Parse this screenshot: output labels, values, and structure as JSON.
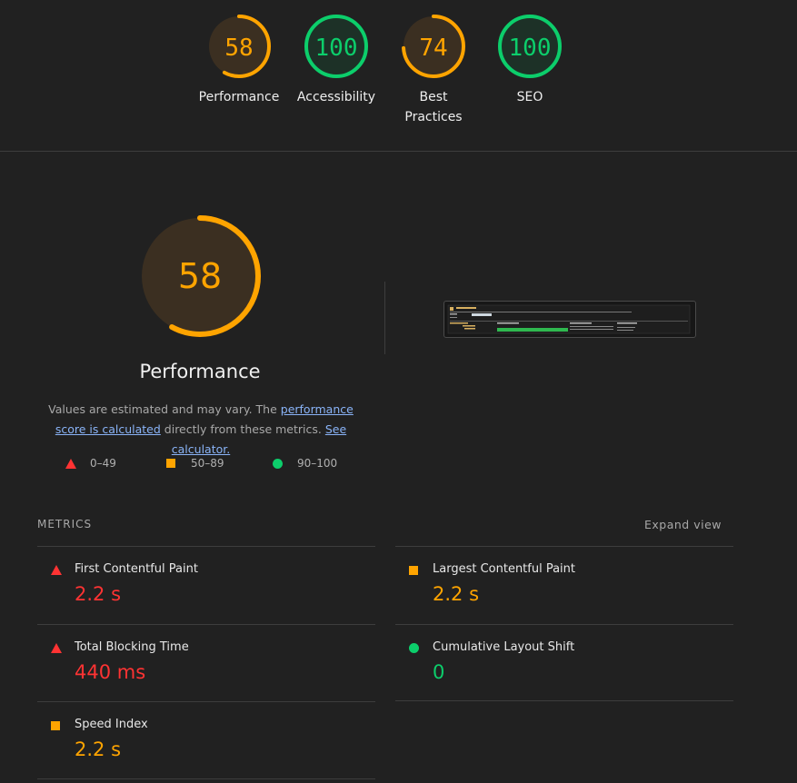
{
  "colors": {
    "fail": "#ff3333",
    "average": "#ffa400",
    "pass": "#0cce6b",
    "average_bg": "#3b2f21",
    "pass_bg": "#1d3127"
  },
  "scores": [
    {
      "label": "Performance",
      "value": "58",
      "status": "average"
    },
    {
      "label": "Accessibility",
      "value": "100",
      "status": "pass"
    },
    {
      "label": "Best Practices",
      "value": "74",
      "status": "average"
    },
    {
      "label": "SEO",
      "value": "100",
      "status": "pass"
    }
  ],
  "performance": {
    "score": "58",
    "title": "Performance",
    "desc_1": "Values are estimated and may vary. The ",
    "link_1": "performance score is calculated",
    "desc_2": " directly from these metrics. ",
    "link_2": "See calculator."
  },
  "legend": {
    "fail": "0–49",
    "average": "50–89",
    "pass": "90–100"
  },
  "metrics": {
    "title": "METRICS",
    "expand_label": "Expand view",
    "items": [
      {
        "label": "First Contentful Paint",
        "value": "2.2 s",
        "status": "fail",
        "icon": "triangle-icon"
      },
      {
        "label": "Largest Contentful Paint",
        "value": "2.2 s",
        "status": "average",
        "icon": "square-icon"
      },
      {
        "label": "Total Blocking Time",
        "value": "440 ms",
        "status": "fail",
        "icon": "triangle-icon"
      },
      {
        "label": "Cumulative Layout Shift",
        "value": "0",
        "status": "pass",
        "icon": "circle-icon"
      },
      {
        "label": "Speed Index",
        "value": "2.2 s",
        "status": "average",
        "icon": "square-icon"
      }
    ]
  }
}
